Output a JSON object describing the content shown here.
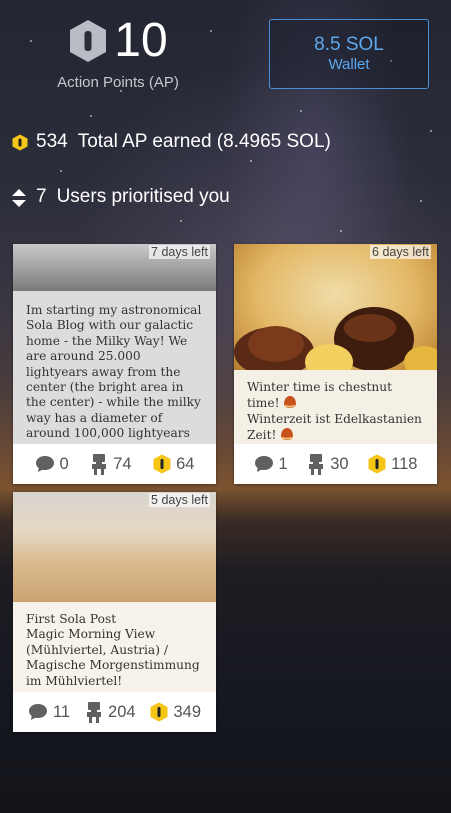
{
  "header": {
    "ap_value": "10",
    "ap_label": "Action Points (AP)",
    "wallet_amount": "8.5 SOL",
    "wallet_label": "Wallet"
  },
  "stats": {
    "total_ap_count": "534",
    "total_ap_text": "Total AP earned (8.4965 SOL)",
    "users_count": "7",
    "users_text": "Users prioritised you"
  },
  "cards": [
    {
      "days_left": "7 days left",
      "text": "Im starting my astronomical Sola Blog with our galactic home - the Milky Way! We are around 25.000 lightyears away from the center (the bright area in the center) - while the milky way has a diameter of around 100,000 lightyears",
      "comments": "0",
      "views": "74",
      "ap": "64"
    },
    {
      "days_left": "6 days left",
      "line1": "Winter time is chestnut time!",
      "line2": "Winterzeit ist Edelkastanien Zeit!",
      "comments": "1",
      "views": "30",
      "ap": "118"
    },
    {
      "days_left": "5 days left",
      "text": "First Sola Post\nMagic Morning View (Mühlviertel, Austria) / Magische Morgenstimmung im Mühlviertel!",
      "comments": "11",
      "views": "204",
      "ap": "349"
    }
  ],
  "icons": {
    "ap": "hexagon-ap-icon",
    "users": "sort-arrows-icon",
    "comment": "comment-bubble-icon",
    "view": "person-view-icon",
    "chestnut": "chestnut-emoji"
  },
  "colors": {
    "accent": "#5aa9f0",
    "ap_gold": "#f5c518",
    "hex_gray": "#b9bcc4"
  }
}
